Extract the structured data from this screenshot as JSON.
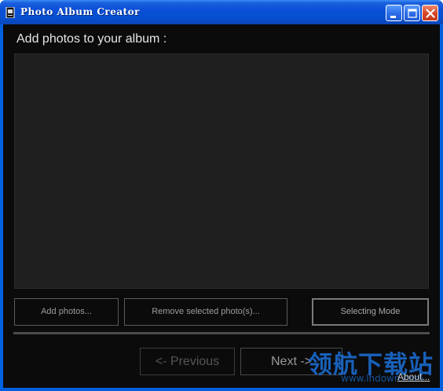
{
  "window": {
    "title": "Photo Album Creator",
    "app_icon": "app-icon",
    "controls": {
      "minimize_icon": "minimize-icon",
      "maximize_icon": "maximize-icon",
      "close_icon": "close-icon"
    },
    "colors": {
      "titlebar": "#0a4fd8",
      "client_background": "#0b0b0b",
      "photo_area": "#1f1f1f",
      "close_button": "#d8482a"
    }
  },
  "main": {
    "heading": "Add photos to your album :",
    "buttons": {
      "add_photos": "Add photos...",
      "remove_selected": "Remove selected photo(s)...",
      "selecting_mode": "Selecting Mode"
    }
  },
  "footer": {
    "previous": "<- Previous",
    "next": "Next ->",
    "about": "About..."
  },
  "watermark": {
    "text": "领航下载站",
    "url": "www.lhdown.com"
  }
}
